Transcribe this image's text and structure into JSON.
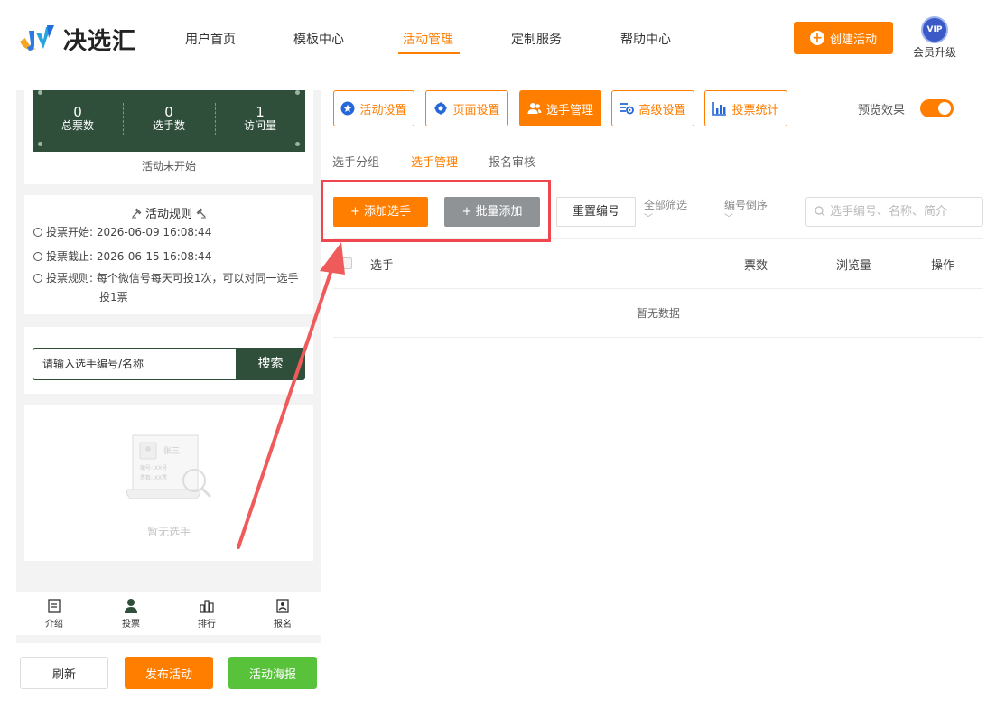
{
  "header": {
    "logo_text": "决选汇",
    "nav": [
      "用户首页",
      "模板中心",
      "活动管理",
      "定制服务",
      "帮助中心"
    ],
    "active_nav": "活动管理",
    "create_label": "创建活动",
    "vip_badge": "VIP",
    "vip_label": "会员升级"
  },
  "preview": {
    "stats": [
      {
        "value": "0",
        "label": "总票数"
      },
      {
        "value": "0",
        "label": "选手数"
      },
      {
        "value": "1",
        "label": "访问量"
      }
    ],
    "status": "活动未开始",
    "rules": {
      "title": "活动规则",
      "start_label": "投票开始:",
      "start": "2026-06-09 16:08:44",
      "end_label": "投票截止:",
      "end": "2026-06-15 16:08:44",
      "rule_label": "投票规则:",
      "rule_line1": "每个微信号每天可投1次，可以对同一选手",
      "rule_line2": "投1票"
    },
    "search_placeholder": "请输入选手编号/名称",
    "search_btn": "搜索",
    "empty_card_name": "张三",
    "empty_card_line1": "编号: XX号",
    "empty_card_line2": "票数: XX票",
    "empty_text": "暂无选手",
    "tabs": [
      "介绍",
      "投票",
      "排行",
      "报名"
    ],
    "refresh": "刷新",
    "publish": "发布活动",
    "poster": "活动海报"
  },
  "toolbar": {
    "buttons": [
      "活动设置",
      "页面设置",
      "选手管理",
      "高级设置",
      "投票统计"
    ],
    "active": "选手管理",
    "preview_label": "预览效果",
    "preview_on": true
  },
  "subtabs": [
    "选手分组",
    "选手管理",
    "报名审核"
  ],
  "active_subtab": "选手管理",
  "actions": {
    "add": "+ 添加选手",
    "batch": "+ 批量添加",
    "reset": "重置编号",
    "filter": "全部筛选",
    "sort": "编号倒序",
    "search_placeholder": "选手编号、名称、简介"
  },
  "table": {
    "headers": [
      "选手",
      "票数",
      "浏览量",
      "操作"
    ],
    "empty": "暂无数据"
  },
  "colors": {
    "accent": "#ff7e00",
    "dark_green": "#2f4f3b",
    "green": "#58c23a",
    "highlight": "#f0474f"
  }
}
